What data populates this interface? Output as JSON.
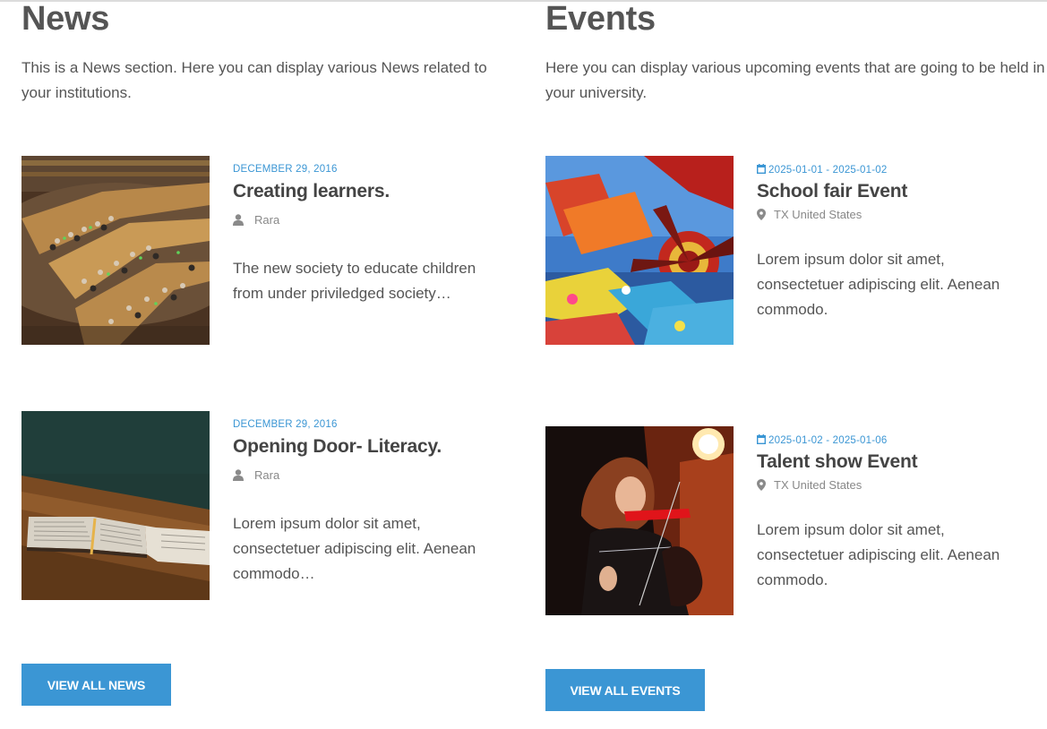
{
  "news": {
    "title": "News",
    "description": "This is a News section. Here you can display various News related to your institutions.",
    "items": [
      {
        "date": "DECEMBER 29, 2016",
        "title": "Creating learners.",
        "author": "Rara",
        "excerpt": "The new society to educate children from under priviledged society…",
        "image": "library-reading-room"
      },
      {
        "date": "DECEMBER 29, 2016",
        "title": "Opening Door- Literacy.",
        "author": "Rara",
        "excerpt": "Lorem ipsum dolor sit amet, consectetuer adipiscing elit. Aenean commodo…",
        "image": "open-book"
      }
    ],
    "button_label": "VIEW ALL NEWS"
  },
  "events": {
    "title": "Events",
    "description": "Here you can display various upcoming events that are going to be held in your university.",
    "items": [
      {
        "date": "2025-01-01 - 2025-01-02",
        "title": "School fair Event",
        "location": "TX United States",
        "excerpt": "Lorem ipsum dolor sit amet, consectetuer adipiscing elit. Aenean commodo.",
        "image": "fair-ride"
      },
      {
        "date": "2025-01-02 - 2025-01-06",
        "title": "Talent show Event",
        "location": "TX United States",
        "excerpt": "Lorem ipsum dolor sit amet, consectetuer adipiscing elit. Aenean commodo.",
        "image": "violin-performer"
      }
    ],
    "button_label": "VIEW ALL EVENTS"
  },
  "icons": {
    "author": "user-icon",
    "location": "map-pin-icon",
    "date": "calendar-icon"
  },
  "colors": {
    "accent": "#3b96d4",
    "heading": "#555555",
    "meta": "#888888"
  }
}
